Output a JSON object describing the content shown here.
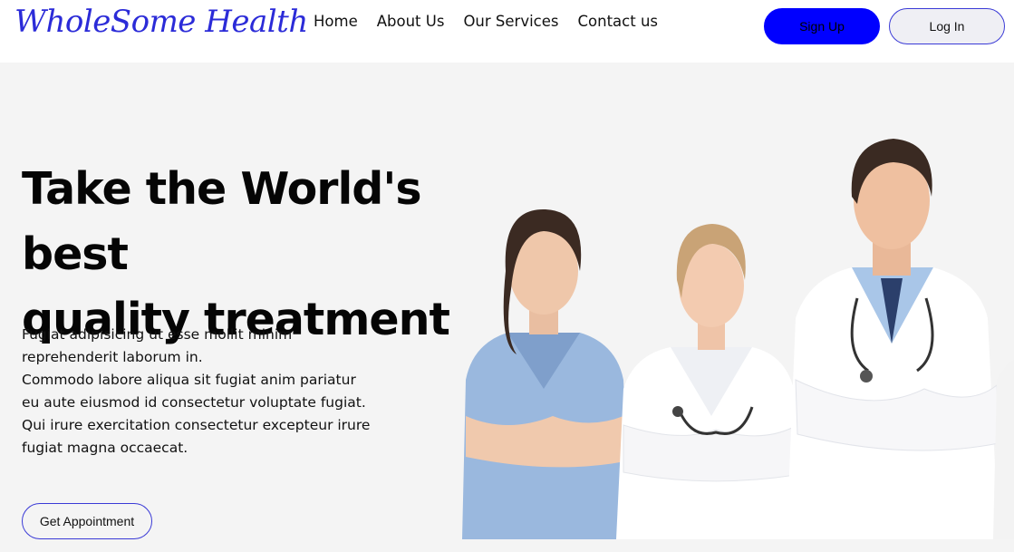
{
  "header": {
    "logo_text": "WholeSome Health",
    "nav": [
      {
        "label": "Home"
      },
      {
        "label": "About Us"
      },
      {
        "label": "Our Services"
      },
      {
        "label": "Contact us"
      }
    ],
    "signup_label": "Sign Up",
    "login_label": "Log In"
  },
  "hero": {
    "title_line1": "Take the World's best",
    "title_line2": "quality treatment",
    "paragraph_lines": [
      "Fugiat adipisicing ut esse mollit minim",
      "reprehenderit laborum in.",
      "Commodo labore aliqua sit fugiat anim pariatur",
      "eu aute eiusmod id consectetur voluptate fugiat.",
      "Qui irure exercitation consectetur excepteur irure",
      "fugiat magna occaecat."
    ],
    "cta_label": "Get Appointment"
  },
  "colors": {
    "brand": "#2b2bd8",
    "primary_button": "#0000ff",
    "hero_background": "#f4f4f4"
  }
}
